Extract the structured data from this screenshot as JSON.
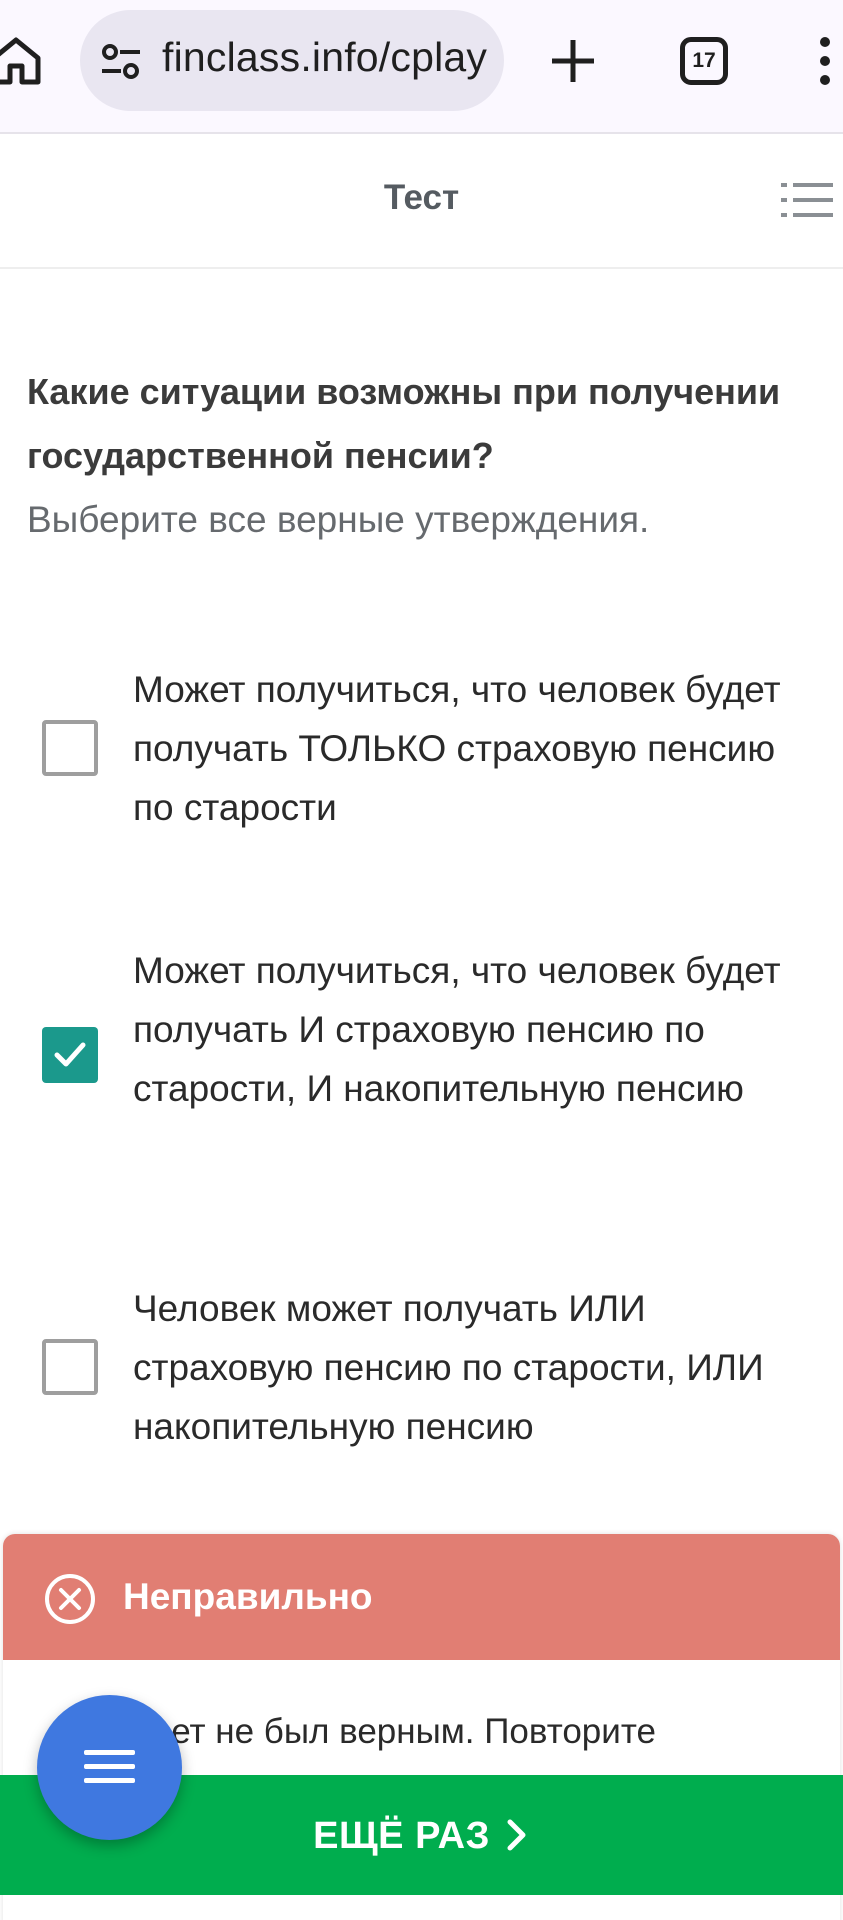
{
  "browser": {
    "url": "finclass.info/cplay",
    "tab_count": "17",
    "icons": [
      "home-icon",
      "site-settings-icon",
      "new-tab-icon",
      "tab-switcher-icon",
      "more-menu-icon"
    ]
  },
  "header": {
    "title": "Тест",
    "menu_icon": "list-icon"
  },
  "question": {
    "title": "Какие ситуации возможны при получении государственной пенсии?",
    "hint": "Выберите все верные утверждения."
  },
  "options": [
    {
      "text": "Может получиться, что человек будет получать ТОЛЬКО страховую пенсию по старости",
      "checked": false
    },
    {
      "text": "Может получиться, что человек будет получать И страховую пенсию по старости, И накопительную пенсию",
      "checked": true
    },
    {
      "text": "Человек может получать ИЛИ страховую пенсию по старости, ИЛИ накопительную пенсию",
      "checked": false
    }
  ],
  "feedback": {
    "status": "Неправильно",
    "message_visible": "вет не был верным. Повторите",
    "icon": "close-circle-icon",
    "color": "#e17e73"
  },
  "retry": {
    "label": "ЕЩЁ РАЗ",
    "icon": "chevron-right-icon",
    "color": "#00ad4e"
  },
  "fab": {
    "icon": "menu-icon",
    "color": "#3f78e0"
  },
  "colors": {
    "checkbox_checked": "#1b998c"
  }
}
